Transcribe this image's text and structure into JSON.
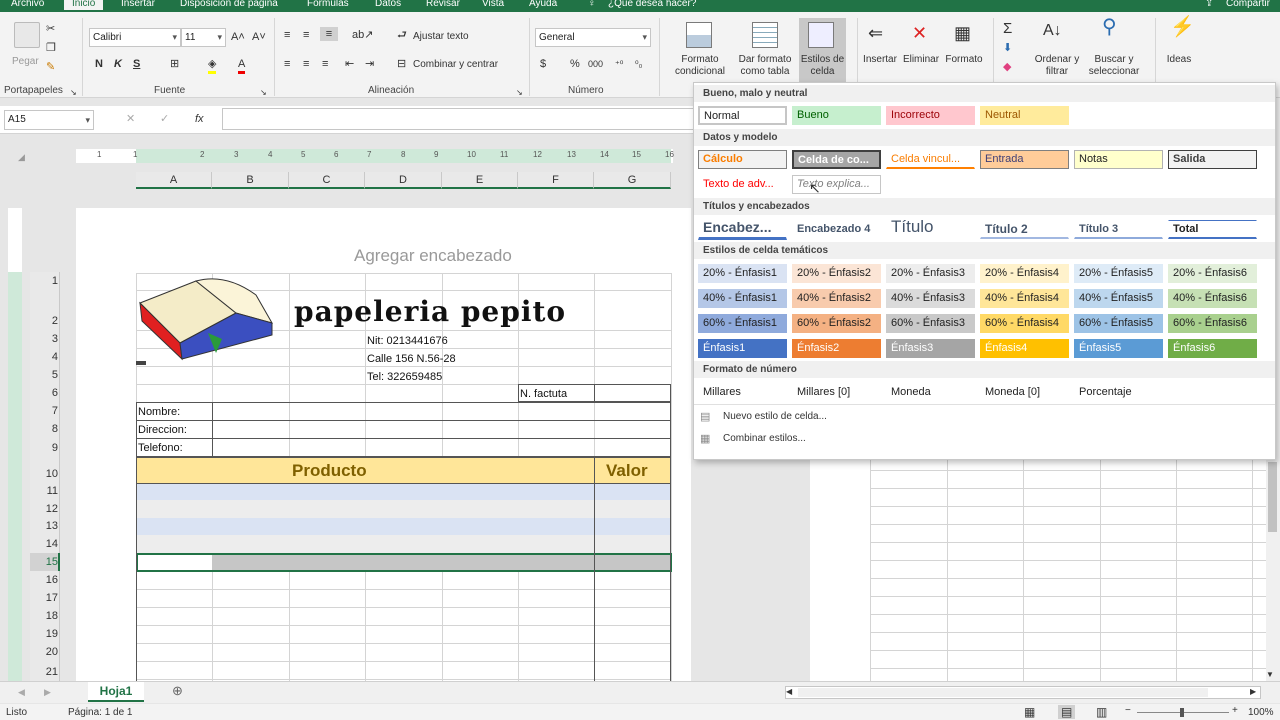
{
  "tabs": [
    "Archivo",
    "Inicio",
    "Insertar",
    "Disposición de página",
    "Fórmulas",
    "Datos",
    "Revisar",
    "Vista",
    "Ayuda",
    "¿Qué desea hacer?"
  ],
  "share": "Compartir",
  "clipboard": {
    "paste": "Pegar",
    "group": "Portapapeles"
  },
  "font": {
    "name": "Calibri",
    "size": "11",
    "group": "Fuente",
    "bold": "N",
    "italic": "K",
    "underline": "S"
  },
  "alignment": {
    "wrap": "Ajustar texto",
    "merge": "Combinar y centrar",
    "group": "Alineación"
  },
  "number": {
    "format": "General",
    "group": "Número",
    "currency": "$",
    "percent": "%",
    "thousands": "000"
  },
  "styles_buttons": [
    "Formato condicional",
    "Dar formato como tabla",
    "Estilos de celda"
  ],
  "cells_buttons": [
    "Insertar",
    "Eliminar",
    "Formato"
  ],
  "editing_buttons": [
    "Ordenar y filtrar",
    "Buscar y seleccionar"
  ],
  "ideas": "Ideas",
  "namebox": "A15",
  "fx": "fx",
  "header_placeholder": "Agregar encabezado",
  "ruler": [
    "1",
    "1",
    "2",
    "3",
    "4",
    "5",
    "6",
    "7",
    "8",
    "9",
    "10",
    "11",
    "12",
    "13",
    "14",
    "15",
    "16"
  ],
  "columns": [
    "A",
    "B",
    "C",
    "D",
    "E",
    "F",
    "G"
  ],
  "rows": [
    "1",
    "2",
    "3",
    "4",
    "5",
    "6",
    "7",
    "8",
    "9",
    "10",
    "11",
    "12",
    "13",
    "14",
    "15",
    "16",
    "17",
    "18",
    "19",
    "20",
    "21"
  ],
  "invoice": {
    "title": "papeleria pepito",
    "nit": "Nit: 0213441676",
    "address": "Calle 156 N.56-28",
    "tel": "Tel: 322659485",
    "invoice_no": "N. factuta",
    "name": "Nombre:",
    "dir": "Direccion:",
    "phone": "Telefono:",
    "product": "Producto",
    "value": "Valor"
  },
  "panel": {
    "sections": [
      "Bueno, malo y neutral",
      "Datos y modelo",
      "Títulos y encabezados",
      "Estilos de celda temáticos",
      "Formato de número"
    ],
    "good_bad": [
      "Normal",
      "Bueno",
      "Incorrecto",
      "Neutral"
    ],
    "data_model": [
      "Cálculo",
      "Celda de co...",
      "Celda vincul...",
      "Entrada",
      "Notas",
      "Salida",
      "Texto de adv...",
      "Texto explica..."
    ],
    "titles": [
      "Encabez...",
      "Encabezado 4",
      "Título",
      "Título 2",
      "Título 3",
      "Total"
    ],
    "themed": [
      "20% - Énfasis1",
      "20% - Énfasis2",
      "20% - Énfasis3",
      "20% - Énfasis4",
      "20% - Énfasis5",
      "20% - Énfasis6",
      "40% - Énfasis1",
      "40% - Énfasis2",
      "40% - Énfasis3",
      "40% - Énfasis4",
      "40% - Énfasis5",
      "40% - Énfasis6",
      "60% - Énfasis1",
      "60% - Énfasis2",
      "60% - Énfasis3",
      "60% - Énfasis4",
      "60% - Énfasis5",
      "60% - Énfasis6",
      "Énfasis1",
      "Énfasis2",
      "Énfasis3",
      "Énfasis4",
      "Énfasis5",
      "Énfasis6"
    ],
    "numfmt": [
      "Millares",
      "Millares [0]",
      "Moneda",
      "Moneda [0]",
      "Porcentaje"
    ],
    "new_style": "Nuevo estilo de celda...",
    "merge_styles": "Combinar estilos..."
  },
  "sheet_tab": "Hoja1",
  "status": {
    "ready": "Listo",
    "page": "Página: 1 de 1",
    "zoom": "100%"
  },
  "colors": {
    "excel_green": "#217346",
    "header_fill": "#ffe699",
    "band_blue": "#dae3f3"
  }
}
